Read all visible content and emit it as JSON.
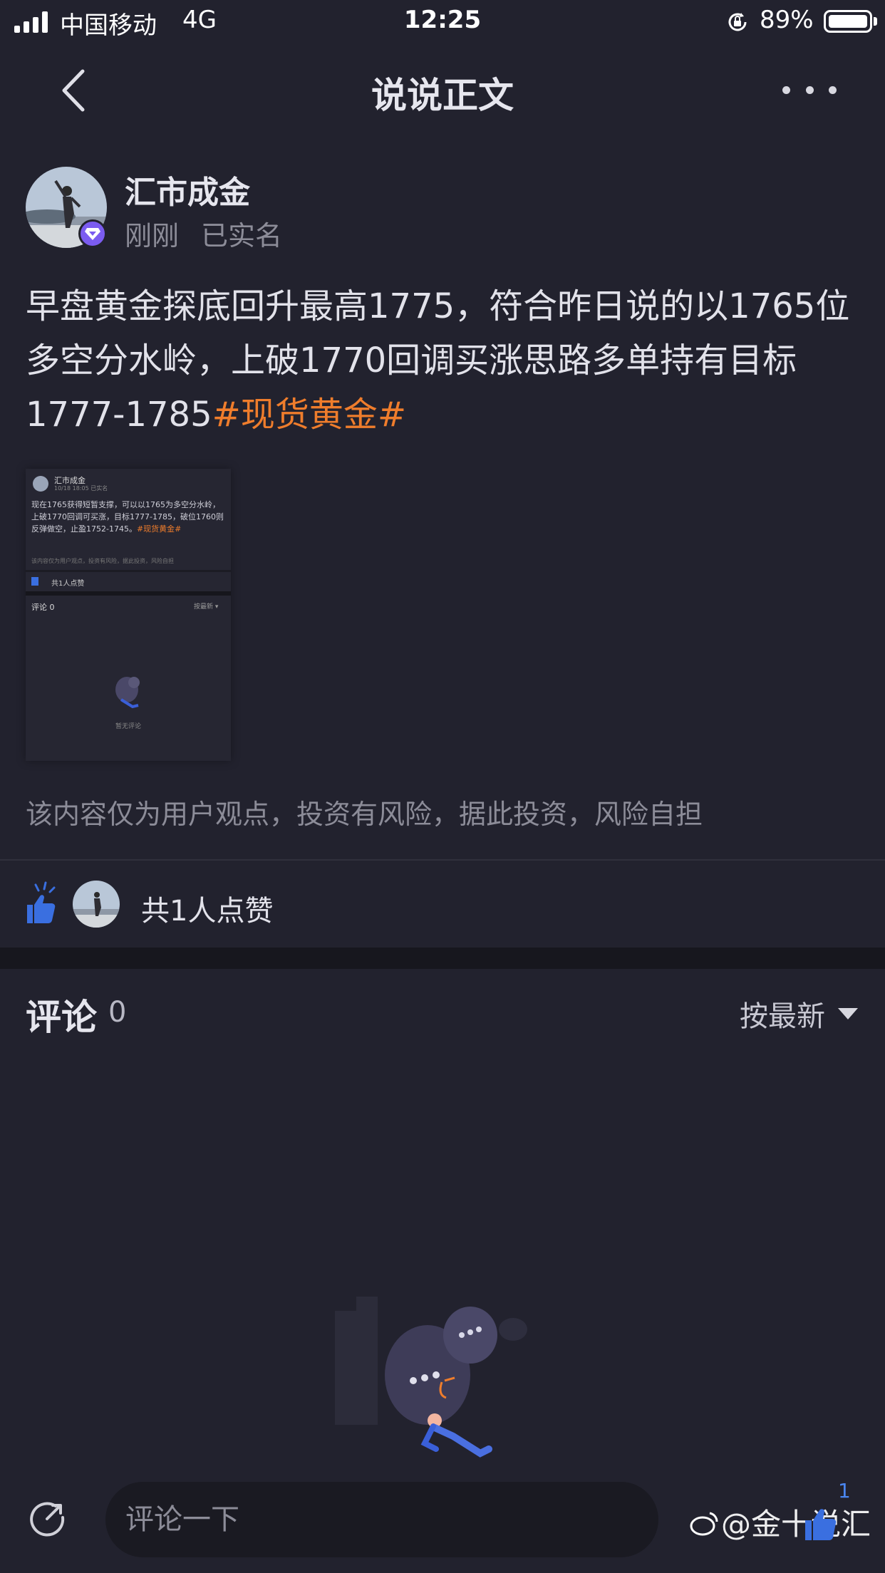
{
  "status_bar": {
    "carrier": "中国移动",
    "network": "4G",
    "time": "12:25",
    "battery": "89%"
  },
  "nav": {
    "title": "说说正文",
    "back_icon": "chevron-left-icon",
    "more_icon": "more-dots-icon"
  },
  "post": {
    "author": "汇市成金",
    "time": "刚刚",
    "verification": "已实名",
    "body": "早盘黄金探底回升最高1775，符合昨日说的以1765位多空分水岭，上破1770回调买涨思路多单持有目标1777-1785",
    "tag": "#现货黄金#",
    "disclaimer": "该内容仅为用户观点，投资有风险，据此投资，风险自担"
  },
  "thumbnail": {
    "author": "汇市成金",
    "meta": "10/18 18:05  已实名",
    "body": "现在1765获得短暂支撑，可以以1765为多空分水岭，上破1770回调可买涨，目标1777-1785，破位1760则反弹做空，止盈1752-1745。",
    "tag": "#现货黄金#",
    "disclaimer": "该内容仅为用户观点，投资有风险，据此投资，风险自担",
    "likes": "共1人点赞",
    "comments": "评论 0",
    "sort": "按最新 ▾",
    "empty": "暂无评论"
  },
  "likes": {
    "text": "共1人点赞",
    "icon": "thumbs-up-icon"
  },
  "comments": {
    "title": "评论",
    "count": "0",
    "sort": "按最新"
  },
  "bottom_bar": {
    "placeholder": "评论一下",
    "like_count": "1",
    "watermark": "@金十说汇"
  },
  "colors": {
    "background": "#22222e",
    "tag": "#ef7d2c",
    "accent_blue": "#3a6fe0",
    "badge_purple": "#7b5cf0"
  }
}
